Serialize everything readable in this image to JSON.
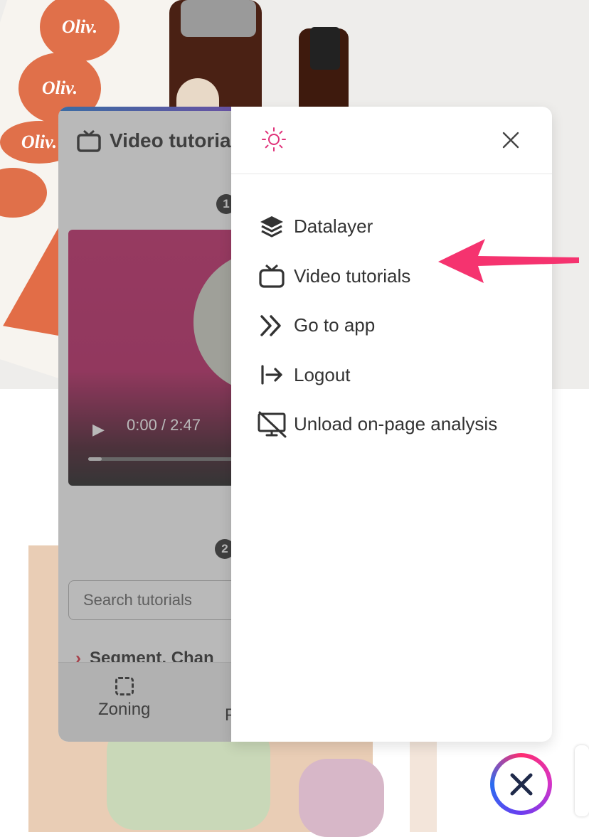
{
  "video_panel": {
    "title": "Video tutorials",
    "steps": [
      "1",
      "2"
    ],
    "video": {
      "current_time": "0:00",
      "duration": "2:47",
      "time_display": "0:00 / 2:47",
      "progress": 0.08
    },
    "search": {
      "placeholder": "Search tutorials"
    },
    "segment_item": "Segment, Chan",
    "footer": {
      "zoning_label": "Zoning",
      "second_label_partial": "P"
    }
  },
  "menu": {
    "items": [
      {
        "label": "Datalayer",
        "icon": "layers-icon"
      },
      {
        "label": "Video tutorials",
        "icon": "tv-icon"
      },
      {
        "label": "Go to app",
        "icon": "double-chevron-right-icon"
      },
      {
        "label": "Logout",
        "icon": "logout-icon"
      },
      {
        "label": "Unload on-page analysis",
        "icon": "monitor-off-icon"
      }
    ]
  },
  "colors": {
    "accent_pink": "#ff2d6f",
    "sun_icon": "#e0337a",
    "annotation_arrow": "#f5336f",
    "text": "#333333"
  },
  "background_brand_text": "Oliv."
}
